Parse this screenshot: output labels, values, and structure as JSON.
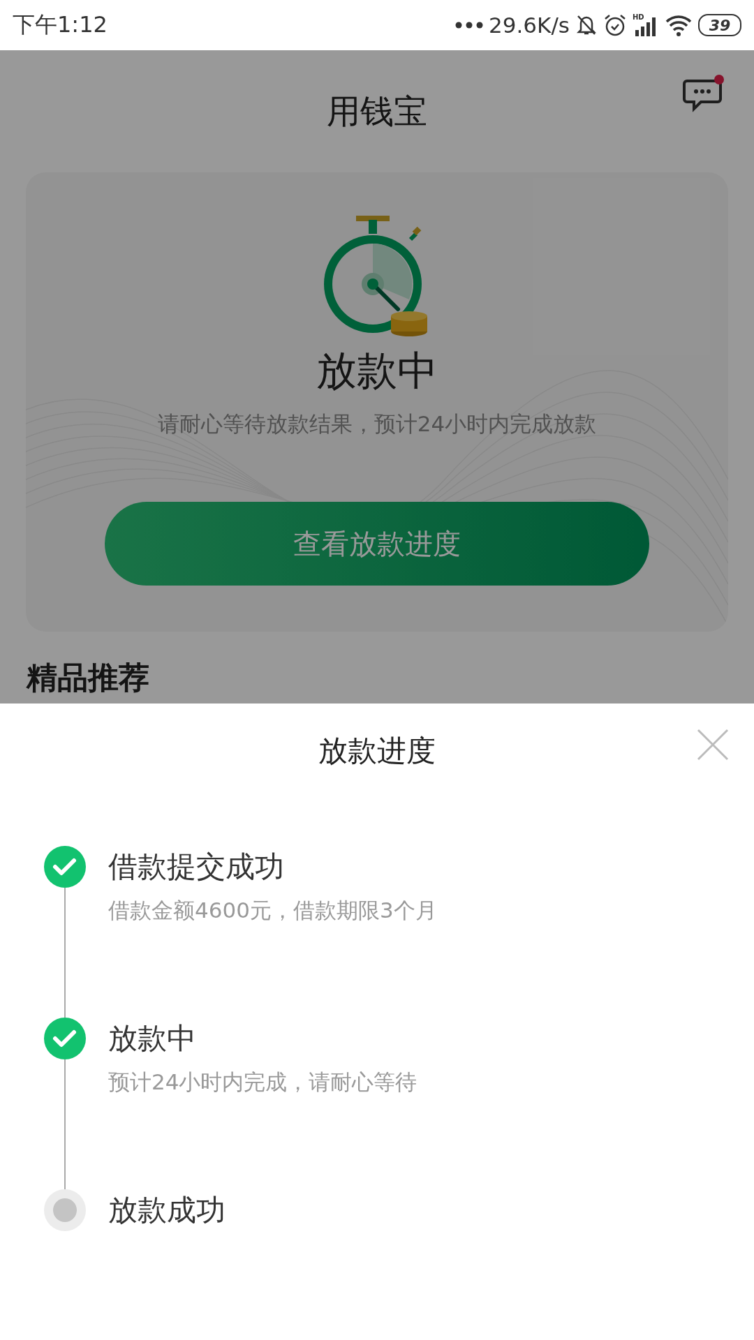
{
  "status_bar": {
    "time": "下午1:12",
    "net_speed": "29.6K/s",
    "network_type": "HD",
    "battery": "39"
  },
  "header": {
    "title": "用钱宝",
    "unread": true
  },
  "card": {
    "status_title": "放款中",
    "message": "请耐心等待放款结果，预计24小时内完成放款",
    "button": "查看放款进度"
  },
  "section_title": "精品推荐",
  "sheet": {
    "title": "放款进度",
    "steps": [
      {
        "title": "借款提交成功",
        "description": "借款金额4600元，借款期限3个月",
        "done": true
      },
      {
        "title": "放款中",
        "description": "预计24小时内完成，请耐心等待",
        "done": true
      },
      {
        "title": "放款成功",
        "done": false
      }
    ]
  }
}
